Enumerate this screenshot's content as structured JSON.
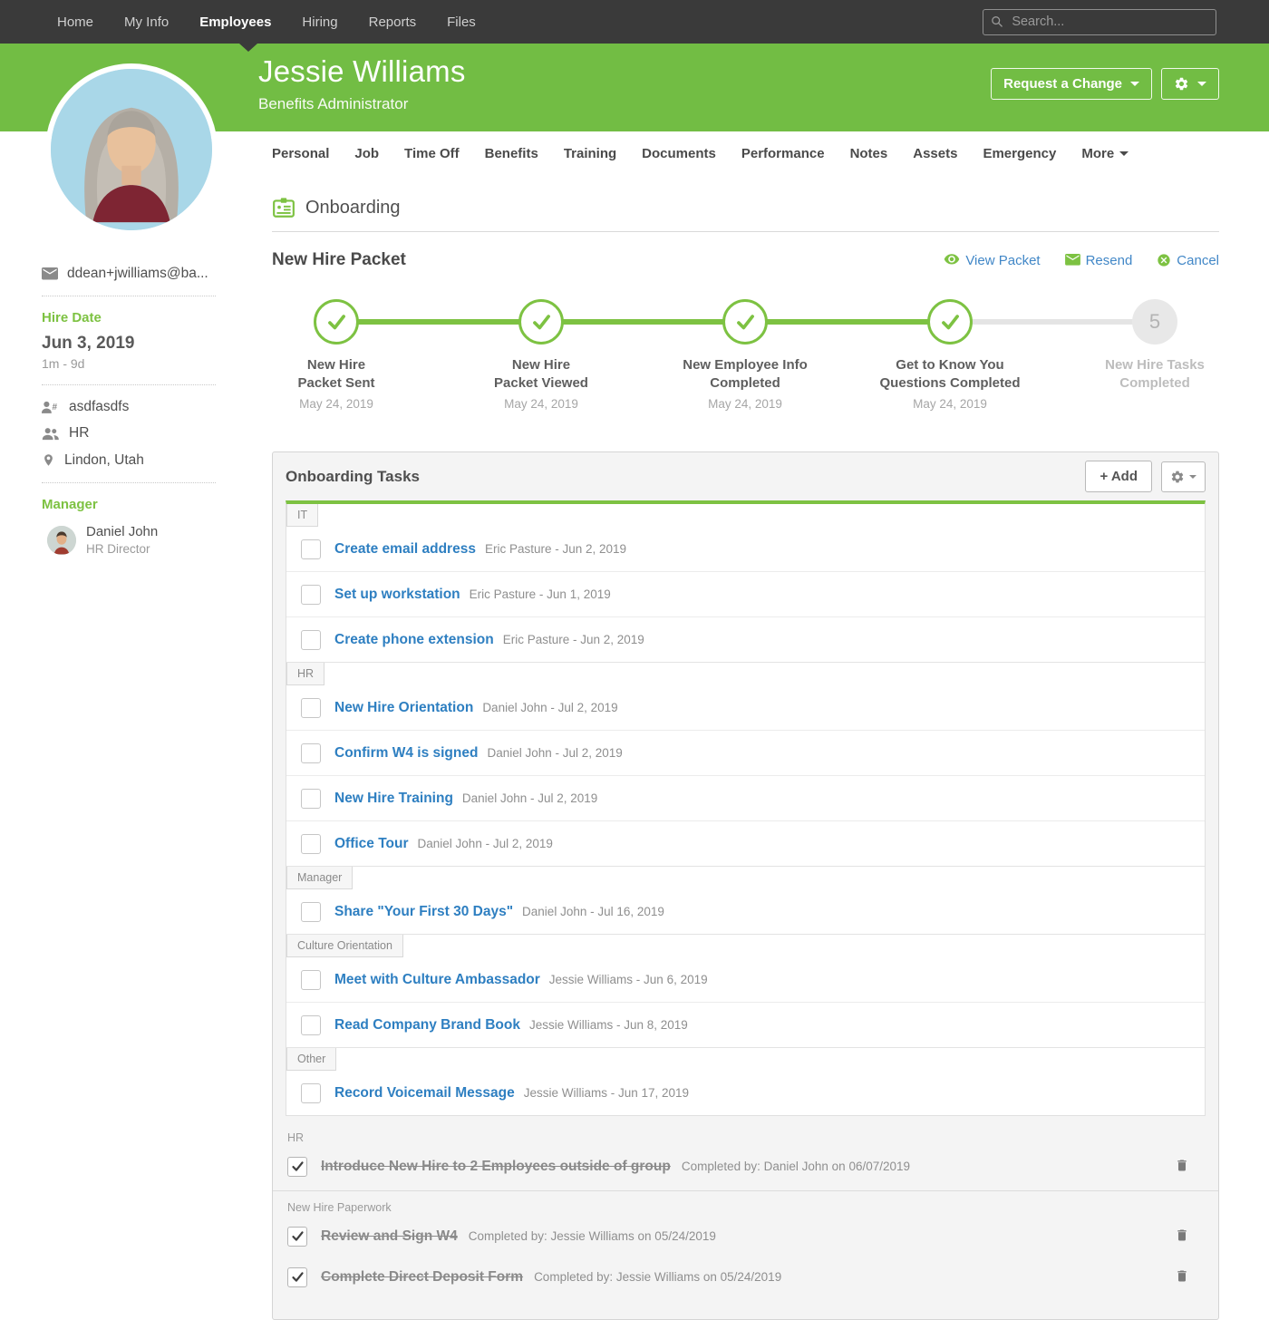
{
  "nav": {
    "items": [
      {
        "label": "Home",
        "active": false
      },
      {
        "label": "My Info",
        "active": false
      },
      {
        "label": "Employees",
        "active": true
      },
      {
        "label": "Hiring",
        "active": false
      },
      {
        "label": "Reports",
        "active": false
      },
      {
        "label": "Files",
        "active": false
      }
    ],
    "search_placeholder": "Search..."
  },
  "header": {
    "name": "Jessie Williams",
    "title": "Benefits Administrator",
    "request_change_label": "Request a Change"
  },
  "tabs": [
    {
      "label": "Personal"
    },
    {
      "label": "Job"
    },
    {
      "label": "Time Off"
    },
    {
      "label": "Benefits"
    },
    {
      "label": "Training"
    },
    {
      "label": "Documents"
    },
    {
      "label": "Performance"
    },
    {
      "label": "Notes"
    },
    {
      "label": "Assets"
    },
    {
      "label": "Emergency"
    },
    {
      "label": "More",
      "has_caret": true
    }
  ],
  "sidebar": {
    "email": "ddean+jwilliams@ba...",
    "hire_date_label": "Hire Date",
    "hire_date": "Jun 3, 2019",
    "tenure": "1m - 9d",
    "employee_id": "asdfasdfs",
    "department": "HR",
    "location": "Lindon, Utah",
    "manager_label": "Manager",
    "manager_name": "Daniel John",
    "manager_title": "HR Director"
  },
  "onboarding": {
    "section_title": "Onboarding",
    "packet_title": "New Hire Packet",
    "actions": [
      {
        "label": "View Packet",
        "icon": "eye-icon"
      },
      {
        "label": "Resend",
        "icon": "resend-envelope-icon"
      },
      {
        "label": "Cancel",
        "icon": "cancel-circle-icon"
      }
    ]
  },
  "stepper": {
    "steps": [
      {
        "line1": "New Hire",
        "line2": "Packet Sent",
        "date": "May 24, 2019",
        "state": "done"
      },
      {
        "line1": "New Hire",
        "line2": "Packet Viewed",
        "date": "May 24, 2019",
        "state": "done"
      },
      {
        "line1": "New Employee Info",
        "line2": "Completed",
        "date": "May 24, 2019",
        "state": "done"
      },
      {
        "line1": "Get to Know You",
        "line2": "Questions Completed",
        "date": "May 24, 2019",
        "state": "done"
      },
      {
        "line1": "New Hire Tasks",
        "line2": "Completed",
        "date": "",
        "state": "pending",
        "number": "5"
      }
    ]
  },
  "tasks_panel": {
    "title": "Onboarding Tasks",
    "add_label": "+ Add",
    "groups": [
      {
        "name": "IT",
        "items": [
          {
            "label": "Create email address",
            "meta": "Eric Pasture - Jun 2, 2019"
          },
          {
            "label": "Set up workstation",
            "meta": "Eric Pasture - Jun 1, 2019"
          },
          {
            "label": "Create phone extension",
            "meta": "Eric Pasture - Jun 2, 2019"
          }
        ]
      },
      {
        "name": "HR",
        "items": [
          {
            "label": "New Hire Orientation",
            "meta": "Daniel John - Jul 2, 2019"
          },
          {
            "label": "Confirm W4 is signed",
            "meta": "Daniel John - Jul 2, 2019"
          },
          {
            "label": "New Hire Training",
            "meta": "Daniel John - Jul 2, 2019"
          },
          {
            "label": "Office Tour",
            "meta": "Daniel John - Jul 2, 2019"
          }
        ]
      },
      {
        "name": "Manager",
        "items": [
          {
            "label": "Share \"Your First 30 Days\"",
            "meta": "Daniel John - Jul 16, 2019"
          }
        ]
      },
      {
        "name": "Culture Orientation",
        "items": [
          {
            "label": "Meet with Culture Ambassador",
            "meta": "Jessie Williams - Jun 6, 2019"
          },
          {
            "label": "Read Company Brand Book",
            "meta": "Jessie Williams - Jun 8, 2019"
          }
        ]
      },
      {
        "name": "Other",
        "items": [
          {
            "label": "Record Voicemail Message",
            "meta": "Jessie Williams - Jun 17, 2019"
          }
        ]
      }
    ]
  },
  "completed_tasks": {
    "groups": [
      {
        "name": "HR",
        "items": [
          {
            "label": "Introduce New Hire to 2 Employees outside of group",
            "meta": "Completed by: Daniel John on 06/07/2019"
          }
        ]
      },
      {
        "name": "New Hire Paperwork",
        "items": [
          {
            "label": "Review and Sign W4",
            "meta": "Completed by: Jessie Williams on 05/24/2019"
          },
          {
            "label": "Complete Direct Deposit Form",
            "meta": "Completed by: Jessie Williams on 05/24/2019"
          }
        ]
      }
    ]
  },
  "colors": {
    "nav_dark": "#3a3a3a",
    "header_green": "#72bd44",
    "accent_green": "#7dc242",
    "link_blue": "#2e7fc1",
    "action_link_blue": "#4187c7"
  },
  "icons": {
    "search-icon": "magnifier",
    "gear-icon": "gear",
    "envelope-icon": "envelope",
    "employee-id-icon": "person+#",
    "department-icon": "two people",
    "location-pin-icon": "map pin",
    "onboarding-badge-icon": "green id badge",
    "eye-icon": "eye",
    "resend-envelope-icon": "green envelope",
    "cancel-circle-icon": "circled x",
    "step-check-icon": "green checkmark",
    "checked-checkbox-icon": "dark checkmark",
    "trash-icon": "trash can",
    "caret-down-icon": "down triangle"
  }
}
